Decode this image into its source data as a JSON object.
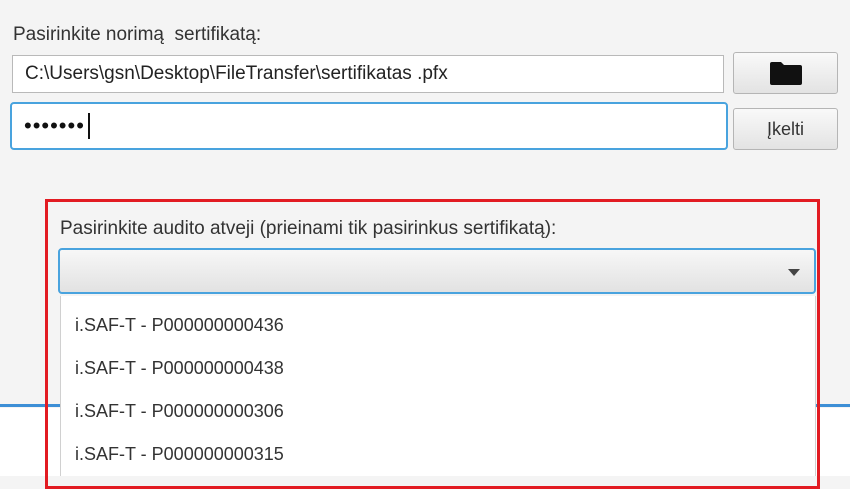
{
  "certificate": {
    "label": "Pasirinkite norimą  sertifikatą:",
    "path_value": "C:\\Users\\gsn\\Desktop\\FileTransfer\\sertifikatas .pfx",
    "browse_icon": "folder-icon",
    "password_mask": "•••••••",
    "upload_label": "Įkelti"
  },
  "audit": {
    "label": "Pasirinkite audito atveji (prieinami tik pasirinkus sertifikatą):",
    "selected_value": "",
    "options": [
      "i.SAF-T - P000000000436",
      "i.SAF-T - P000000000438",
      "i.SAF-T - P000000000306",
      "i.SAF-T - P000000000315"
    ]
  },
  "colors": {
    "focus_blue": "#49a3de",
    "highlight_red": "#e21b22"
  }
}
